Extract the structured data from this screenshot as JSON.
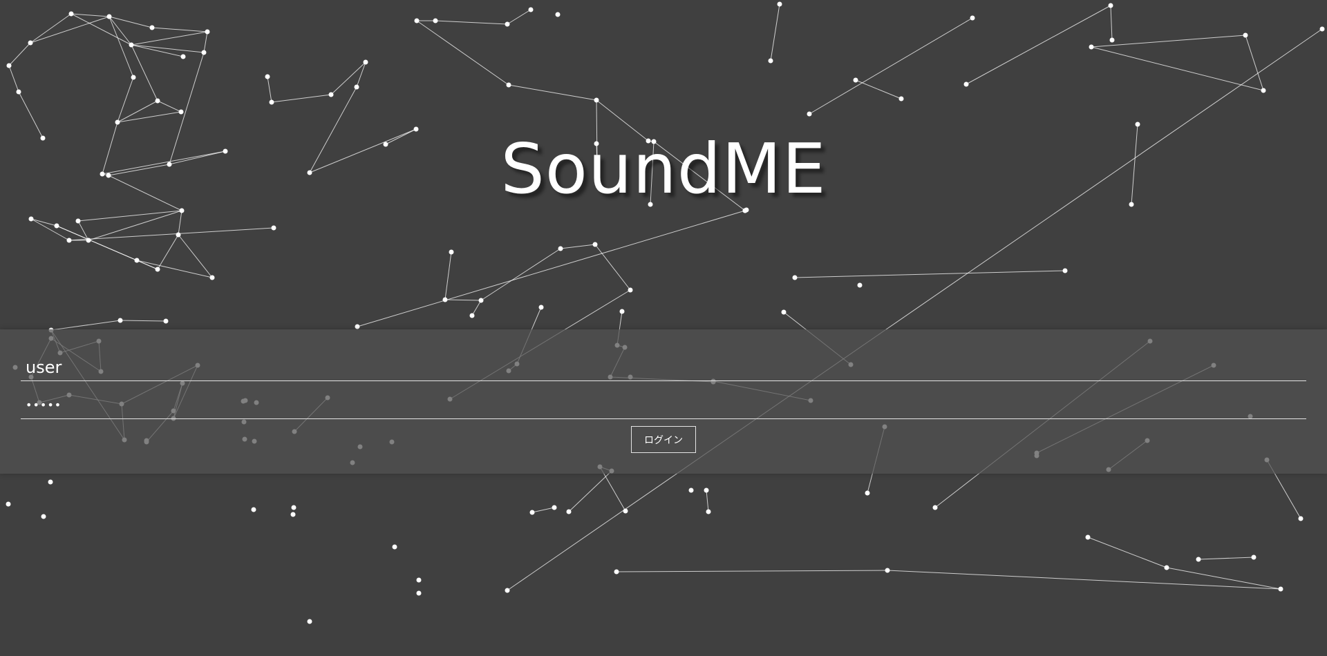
{
  "app": {
    "title": "SoundME"
  },
  "login": {
    "user_value": "user",
    "password_value": "dummy",
    "button_label": "ログイン"
  },
  "colors": {
    "background": "#404040",
    "particle": "#ffffff",
    "band": "#505050"
  }
}
